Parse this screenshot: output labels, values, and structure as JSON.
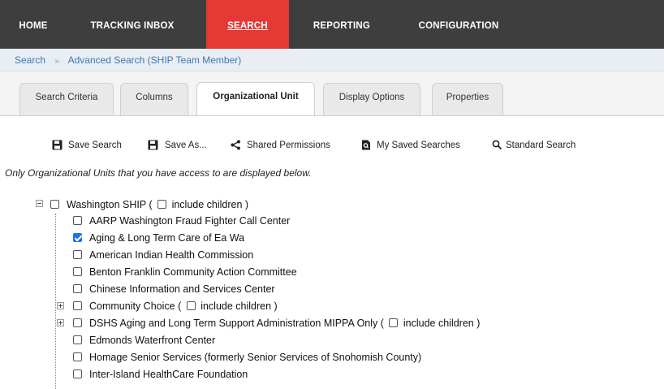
{
  "nav": {
    "items": [
      {
        "label": "HOME"
      },
      {
        "label": "TRACKING INBOX"
      },
      {
        "label": "SEARCH"
      },
      {
        "label": "REPORTING"
      },
      {
        "label": "CONFIGURATION"
      }
    ]
  },
  "breadcrumb": {
    "root": "Search",
    "separator": "»",
    "current": "Advanced Search (SHIP Team Member)"
  },
  "tabs": [
    {
      "label": "Search Criteria"
    },
    {
      "label": "Columns"
    },
    {
      "label": "Organizational Unit"
    },
    {
      "label": "Display Options"
    },
    {
      "label": "Properties"
    }
  ],
  "toolbar": {
    "save_search": "Save Search",
    "save_as": "Save As...",
    "shared_permissions": "Shared Permissions",
    "my_saved_searches": "My Saved Searches",
    "standard_search": "Standard Search"
  },
  "notice": "Only Organizational Units that you have access to are displayed below.",
  "tree": {
    "root": {
      "label_pre": "Washington SHIP (",
      "label_post": "include children )"
    },
    "children": [
      {
        "label": "AARP Washington Fraud Fighter Call Center",
        "checked": false
      },
      {
        "label": "Aging & Long Term Care of Ea Wa",
        "checked": true
      },
      {
        "label": "American Indian Health Commission",
        "checked": false
      },
      {
        "label": "Benton Franklin Community Action Committee",
        "checked": false
      },
      {
        "label": "Chinese Information and Services Center",
        "checked": false
      },
      {
        "label_pre": "Community Choice (",
        "label_post": "include children )",
        "checked": false
      },
      {
        "label_pre": "DSHS Aging and Long Term Support Administration MIPPA Only (",
        "label_post": "include children )",
        "checked": false
      },
      {
        "label": "Edmonds Waterfront Center",
        "checked": false
      },
      {
        "label": "Homage Senior Services (formerly Senior Services of Snohomish County)",
        "checked": false
      },
      {
        "label": "Inter-Island HealthCare Foundation",
        "checked": false
      }
    ]
  },
  "colors": {
    "nav_bg": "#3e3e3e",
    "nav_active": "#e53935",
    "link": "#3b78b5",
    "checkbox_checked": "#1a73e8"
  }
}
